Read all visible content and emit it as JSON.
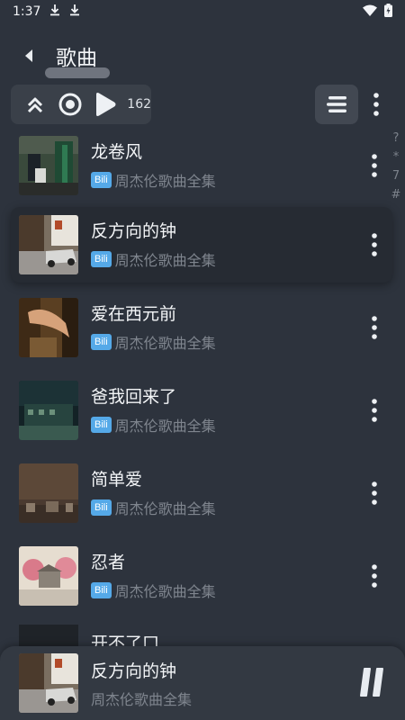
{
  "status_bar": {
    "time": "1:37",
    "icons": [
      "download-icon",
      "download-icon",
      "wifi-icon",
      "battery-icon"
    ]
  },
  "appbar": {
    "title": "歌曲"
  },
  "toolbar": {
    "count": "162"
  },
  "index_bar": [
    "?",
    "*",
    "7",
    "#"
  ],
  "songs": [
    {
      "title": "龙卷风",
      "badge": "Bili",
      "album": "周杰伦歌曲全集",
      "selected": false
    },
    {
      "title": "反方向的钟",
      "badge": "Bili",
      "album": "周杰伦歌曲全集",
      "selected": true
    },
    {
      "title": "爱在西元前",
      "badge": "Bili",
      "album": "周杰伦歌曲全集",
      "selected": false
    },
    {
      "title": "爸我回来了",
      "badge": "Bili",
      "album": "周杰伦歌曲全集",
      "selected": false
    },
    {
      "title": "简单爱",
      "badge": "Bili",
      "album": "周杰伦歌曲全集",
      "selected": false
    },
    {
      "title": "忍者",
      "badge": "Bili",
      "album": "周杰伦歌曲全集",
      "selected": false
    }
  ],
  "partial_song": {
    "title": "开不了口"
  },
  "now_playing": {
    "title": "反方向的钟",
    "subtitle": "周杰伦歌曲全集"
  }
}
